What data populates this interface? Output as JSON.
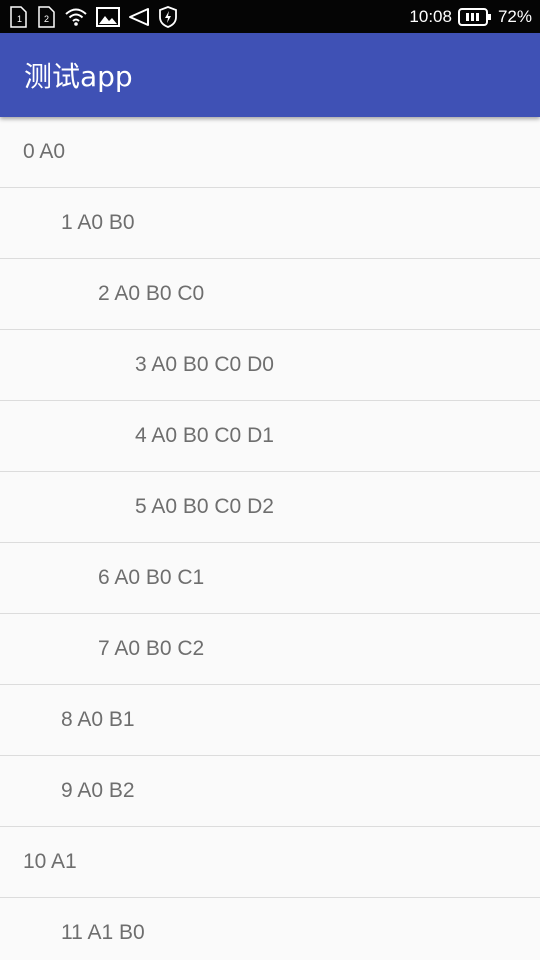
{
  "status_bar": {
    "time": "10:08",
    "battery_percent": "72%",
    "icons": [
      "sim1-icon",
      "sim2-icon",
      "wifi-icon",
      "image-icon",
      "volume-icon",
      "shield-icon",
      "battery-icon"
    ]
  },
  "app_bar": {
    "title": "测试app",
    "color": "#3f51b5"
  },
  "list": {
    "items": [
      {
        "label": "0 A0",
        "level": 0
      },
      {
        "label": "1 A0 B0",
        "level": 1
      },
      {
        "label": "2 A0 B0 C0",
        "level": 2
      },
      {
        "label": "3 A0 B0 C0 D0",
        "level": 3
      },
      {
        "label": "4 A0 B0 C0 D1",
        "level": 3
      },
      {
        "label": "5 A0 B0 C0 D2",
        "level": 3
      },
      {
        "label": "6 A0 B0 C1",
        "level": 2
      },
      {
        "label": "7 A0 B0 C2",
        "level": 2
      },
      {
        "label": "8 A0 B1",
        "level": 1
      },
      {
        "label": "9 A0 B2",
        "level": 1
      },
      {
        "label": "10 A1",
        "level": 0
      },
      {
        "label": "11 A1 B0",
        "level": 1
      }
    ]
  }
}
